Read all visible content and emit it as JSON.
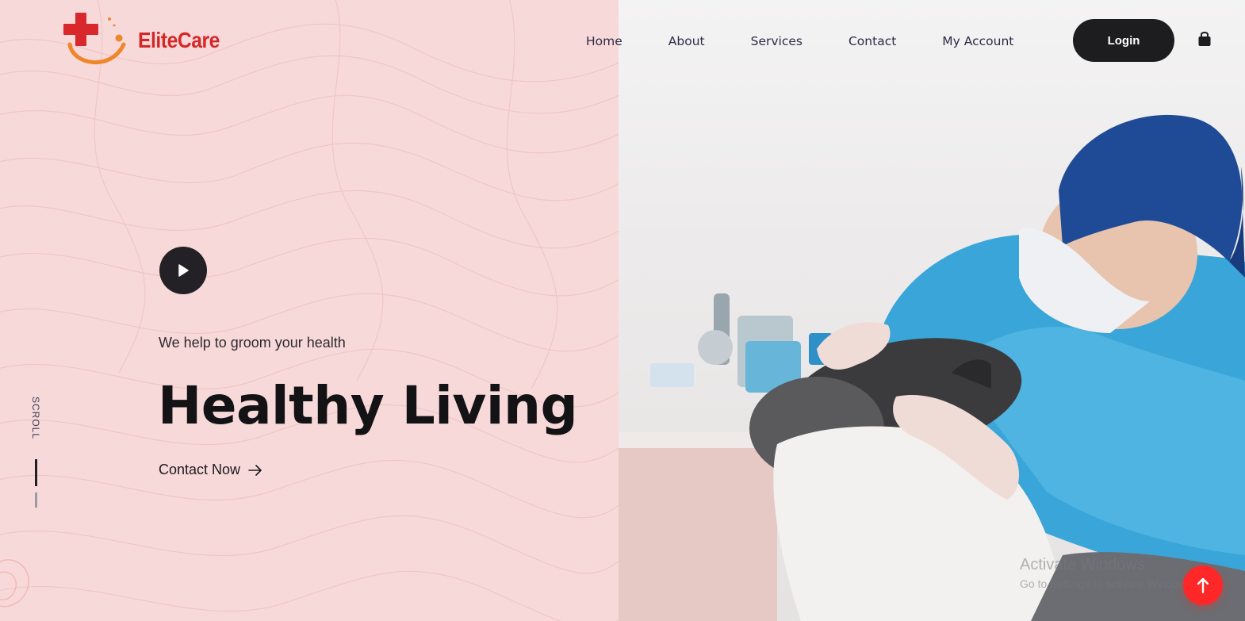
{
  "brand": {
    "name": "EliteCare"
  },
  "nav": {
    "items": [
      {
        "label": "Home"
      },
      {
        "label": "About"
      },
      {
        "label": "Services"
      },
      {
        "label": "Contact"
      },
      {
        "label": "My Account"
      }
    ]
  },
  "header": {
    "login_label": "Login"
  },
  "hero": {
    "tagline": "We help to groom your health",
    "headline": "Healthy Living",
    "cta_label": "Contact Now"
  },
  "scroll": {
    "label": "SCROLL"
  },
  "watermark": {
    "title": "Activate Windows",
    "subtitle": "Go to Settings to activate Windows."
  },
  "colors": {
    "left_bg": "#f8d9d9",
    "brand_red": "#d42828",
    "accent_orange": "#f0862a",
    "dark": "#1d1c1f",
    "back_to_top": "#ff2727"
  },
  "icons": {
    "cart": "shopping-bag-icon",
    "play": "play-icon",
    "arrow": "arrow-right-icon",
    "back_top": "arrow-up-icon"
  }
}
